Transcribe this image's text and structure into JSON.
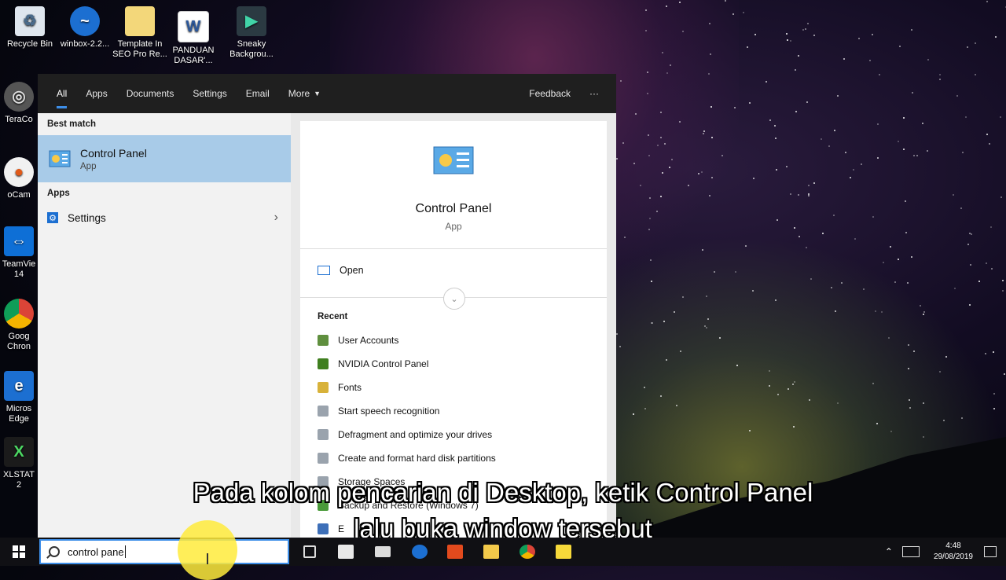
{
  "desktop": {
    "icons": [
      {
        "label": "Recycle Bin",
        "icon": "recycle-bin-icon"
      },
      {
        "label": "winbox-2.2...",
        "icon": "winbox-icon"
      },
      {
        "label": "Template In SEO Pro Re...",
        "icon": "folder-icon"
      },
      {
        "label": "PANDUAN DASAR'...",
        "icon": "word-document-icon"
      },
      {
        "label": "Sneaky Backgrou...",
        "icon": "sneaky-app-icon"
      },
      {
        "label": "TeraCo",
        "icon": "teracopy-icon"
      },
      {
        "label": "oCam",
        "icon": "ocam-icon"
      },
      {
        "label": "TeamVie 14",
        "icon": "teamviewer-icon"
      },
      {
        "label": "Goog Chron",
        "icon": "chrome-icon"
      },
      {
        "label": "Micros Edge",
        "icon": "edge-icon"
      },
      {
        "label": "XLSTAT 2",
        "icon": "xlstat-icon"
      }
    ]
  },
  "search_panel": {
    "tabs": [
      {
        "label": "All",
        "active": true
      },
      {
        "label": "Apps"
      },
      {
        "label": "Documents"
      },
      {
        "label": "Settings"
      },
      {
        "label": "Email"
      },
      {
        "label": "More"
      }
    ],
    "feedback_label": "Feedback",
    "ellipsis_label": "···",
    "best_match_header": "Best match",
    "best_match": {
      "title": "Control Panel",
      "subtitle": "App"
    },
    "apps_header": "Apps",
    "apps": [
      {
        "label": "Settings"
      }
    ],
    "detail": {
      "title": "Control Panel",
      "subtitle": "App",
      "open_label": "Open",
      "recent_header": "Recent",
      "recent": [
        {
          "label": "User Accounts",
          "color": "#5f8f3e"
        },
        {
          "label": "NVIDIA Control Panel",
          "color": "#3f7f1f"
        },
        {
          "label": "Fonts",
          "color": "#d8b23a"
        },
        {
          "label": "Start speech recognition",
          "color": "#9aa3ad"
        },
        {
          "label": "Defragment and optimize your drives",
          "color": "#9aa3ad"
        },
        {
          "label": "Create and format hard disk partitions",
          "color": "#9aa3ad"
        },
        {
          "label": "Storage Spaces",
          "color": "#9aa3ad"
        },
        {
          "label": "Backup and Restore (Windows 7)",
          "color": "#4a9a3a"
        },
        {
          "label": "E",
          "color": "#3d6fb8"
        }
      ]
    }
  },
  "subtitles": {
    "line1": "Pada kolom pencarian di Desktop, ketik Control Panel",
    "line2": "lalu buka window tersebut"
  },
  "taskbar": {
    "search_value": "control pane",
    "apps": [
      "task-view-icon",
      "store-icon",
      "mail-icon",
      "edge-icon",
      "office-icon",
      "file-explorer-icon",
      "chrome-icon",
      "sticky-notes-icon"
    ],
    "time": "4:48",
    "date": "29/08/2019"
  },
  "colors": {
    "accent": "#3d8ee8",
    "best_match_bg": "#a8cbe8",
    "tabs_bg": "#1f1f1f",
    "taskbar_bg": "#101014"
  }
}
